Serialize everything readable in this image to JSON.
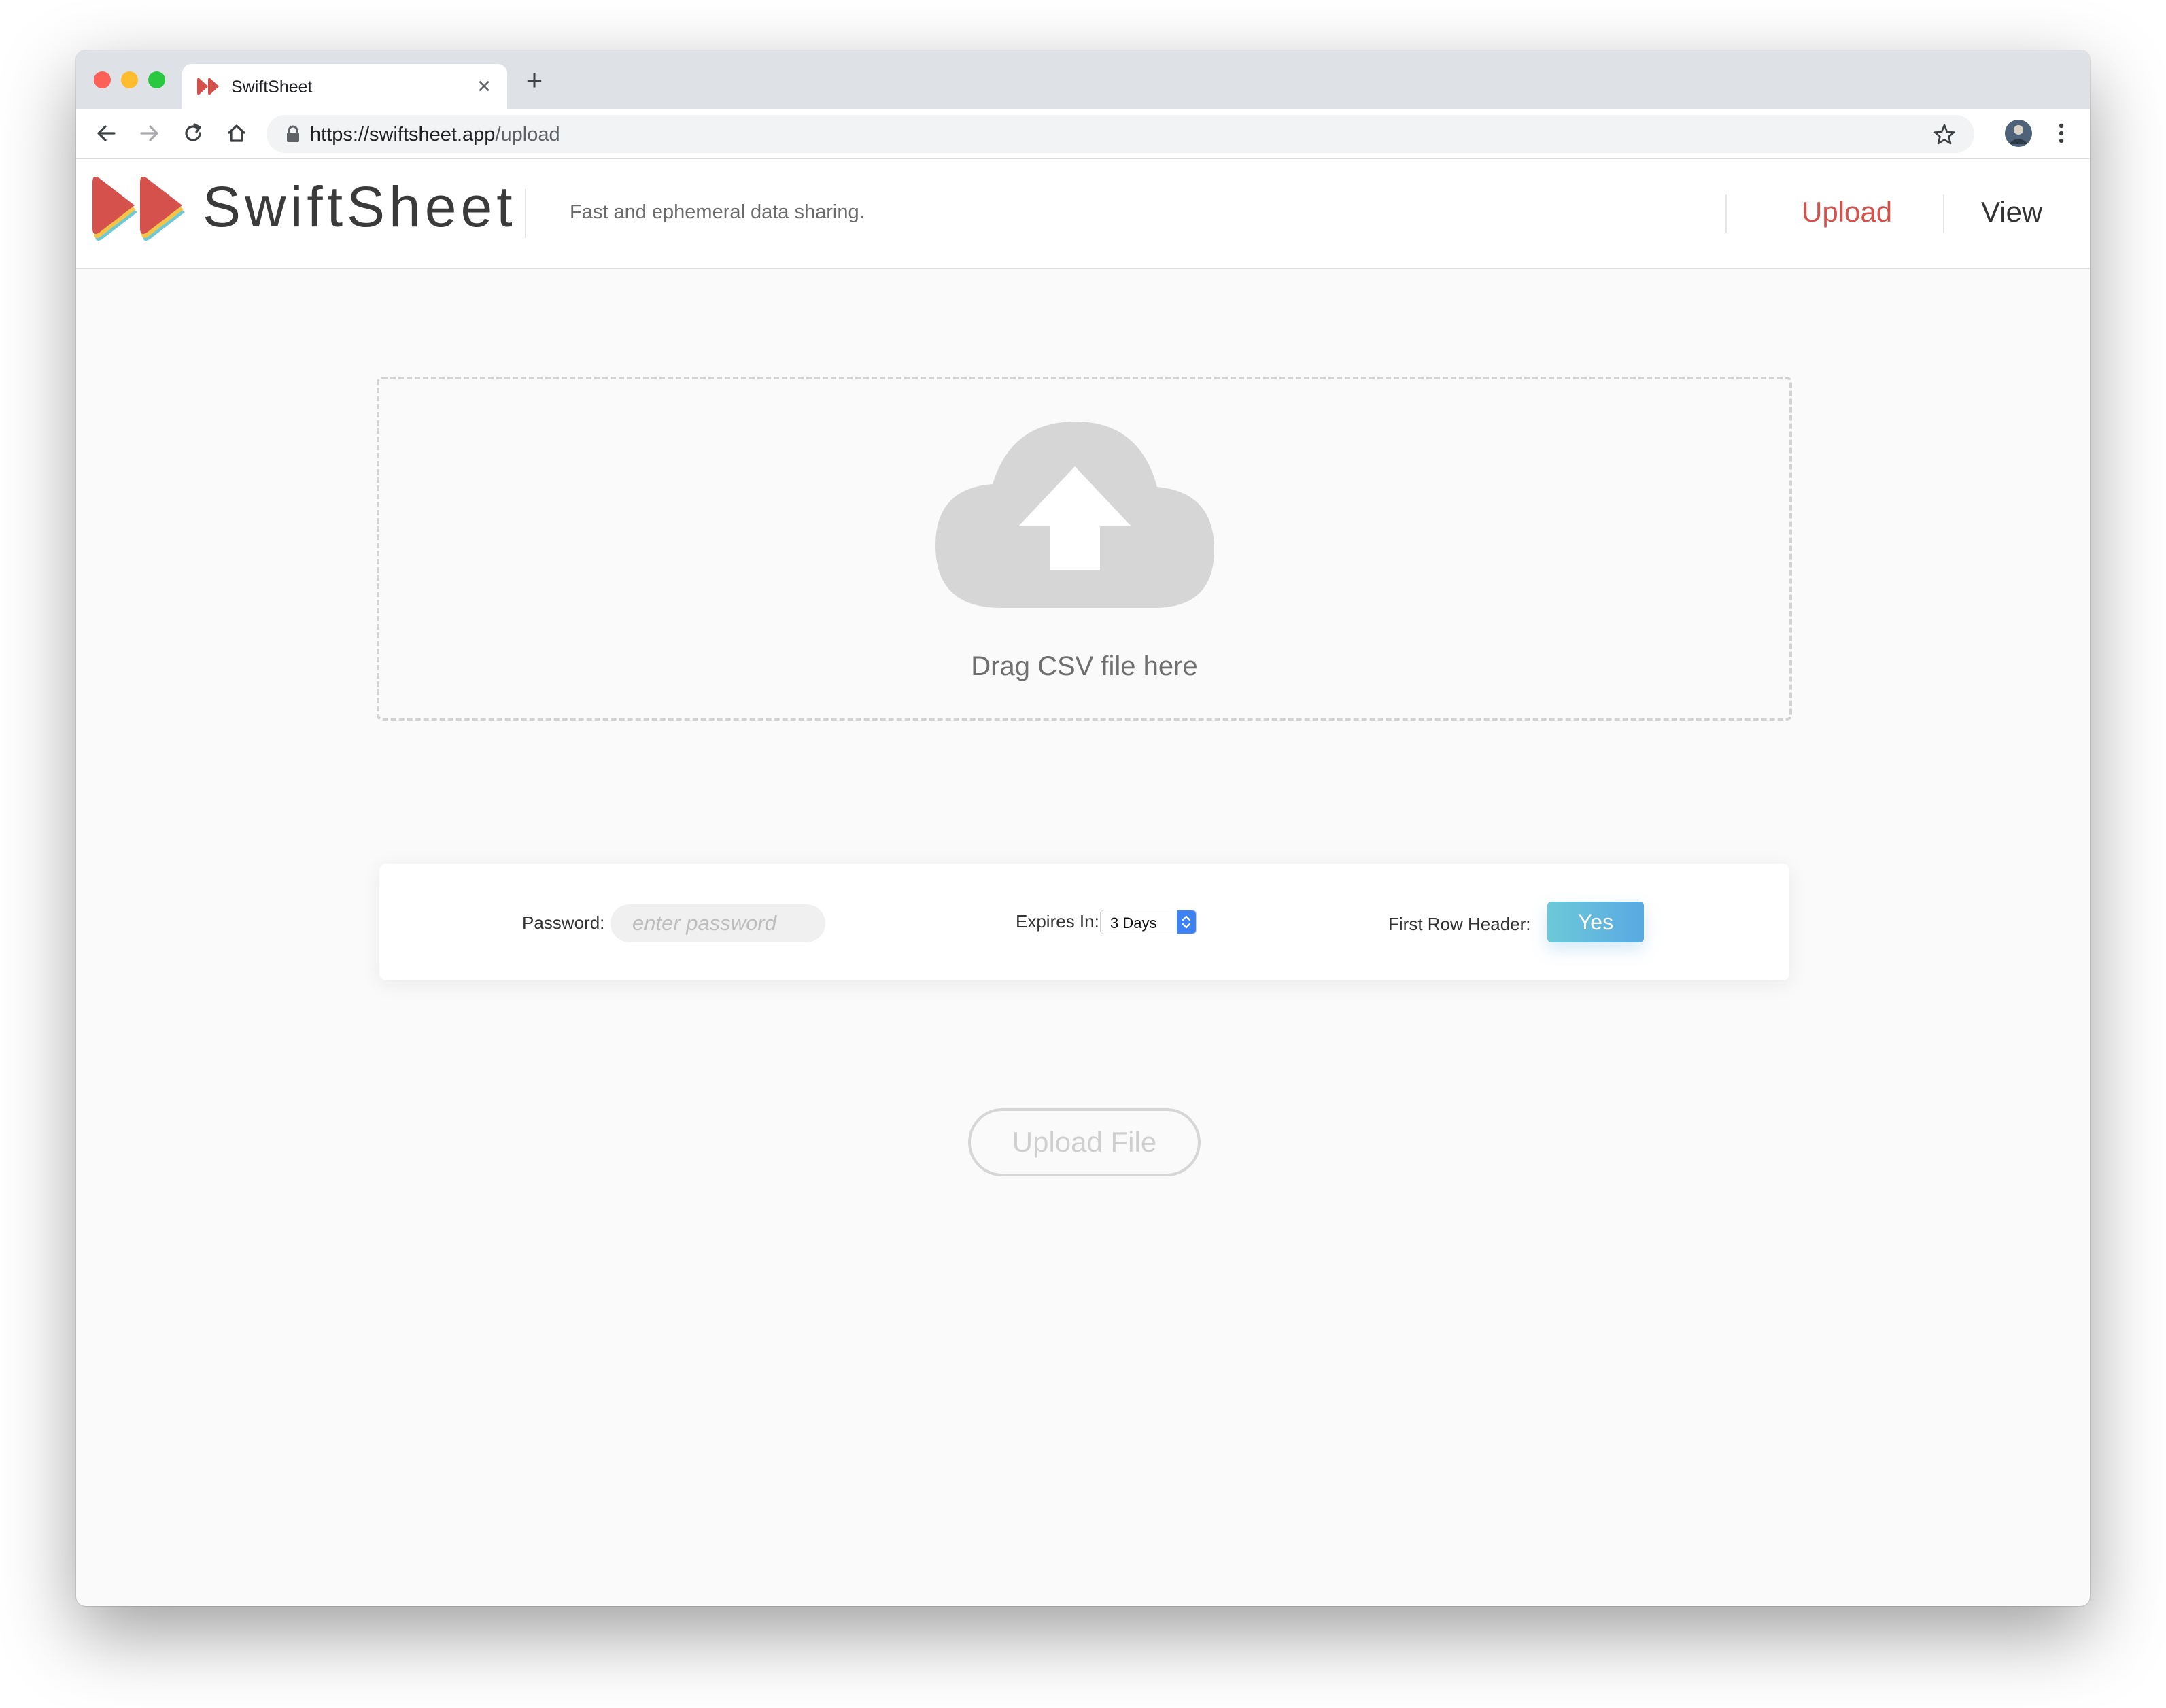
{
  "browser": {
    "tab_title": "SwiftSheet",
    "url_host": "https://swiftsheet.app",
    "url_path": "/upload"
  },
  "header": {
    "brand_name": "SwiftSheet",
    "tagline": "Fast and ephemeral data sharing.",
    "nav": [
      {
        "label": "Upload",
        "active": true
      },
      {
        "label": "View",
        "active": false
      }
    ]
  },
  "dropzone": {
    "label": "Drag CSV file here"
  },
  "options": {
    "password_label": "Password:",
    "password_placeholder": "enter password",
    "expires_label": "Expires In:",
    "expires_value": "3 Days",
    "first_row_label": "First Row Header:",
    "first_row_value": "Yes"
  },
  "upload_button_label": "Upload File",
  "colors": {
    "brand_red": "#d5514b",
    "toggle_blue": "#59a9e2",
    "background": "#fafafa"
  }
}
